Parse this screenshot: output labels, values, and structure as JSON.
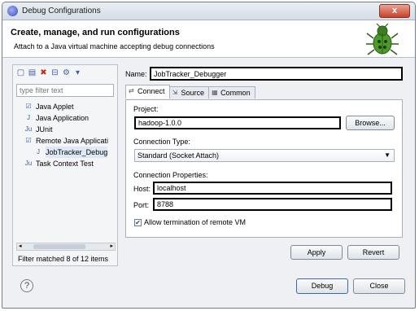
{
  "window": {
    "title": "Debug Configurations",
    "close_glyph": "x"
  },
  "header": {
    "title": "Create, manage, and run configurations",
    "description": "Attach to a Java virtual machine accepting debug connections",
    "icon": "bug-icon"
  },
  "left": {
    "toolbar": [
      {
        "name": "new-config-icon",
        "glyph": "▢"
      },
      {
        "name": "duplicate-icon",
        "glyph": "▤"
      },
      {
        "name": "delete-icon",
        "glyph": "✖"
      },
      {
        "name": "collapse-all-icon",
        "glyph": "⊟"
      },
      {
        "name": "filter-icon",
        "glyph": "⚙"
      },
      {
        "name": "menu-dropdown-icon",
        "glyph": "▾"
      }
    ],
    "filter_placeholder": "type filter text",
    "tree": [
      {
        "label": "Java Applet",
        "indent": 0,
        "icon": "☑"
      },
      {
        "label": "Java Application",
        "indent": 0,
        "icon": "J"
      },
      {
        "label": "JUnit",
        "indent": 0,
        "icon": "Ju"
      },
      {
        "label": "Remote Java Applicati",
        "indent": 0,
        "icon": "☑"
      },
      {
        "label": "JobTracker_Debug",
        "indent": 1,
        "icon": "J",
        "selected": true
      },
      {
        "label": "Task Context Test",
        "indent": 0,
        "icon": "Ju"
      }
    ],
    "status": "Filter matched 8 of 12 items"
  },
  "right": {
    "name_label": "Name:",
    "name_value": "JobTracker_Debugger",
    "tabs": [
      {
        "label": "Connect",
        "icon": "⇄",
        "active": true
      },
      {
        "label": "Source",
        "icon": "⇲",
        "active": false
      },
      {
        "label": "Common",
        "icon": "▦",
        "active": false
      }
    ],
    "project_label": "Project:",
    "project_value": "hadoop-1.0.0",
    "browse_label": "Browse...",
    "connection_type_label": "Connection Type:",
    "connection_type_value": "Standard (Socket Attach)",
    "connection_props_label": "Connection Properties:",
    "host_label": "Host:",
    "host_value": "localhost",
    "port_label": "Port:",
    "port_value": "8788",
    "allow_termination_label": "Allow termination of remote VM",
    "allow_termination_checked": true,
    "apply_label": "Apply",
    "revert_label": "Revert"
  },
  "footer": {
    "help_glyph": "?",
    "debug_label": "Debug",
    "close_label": "Close"
  }
}
